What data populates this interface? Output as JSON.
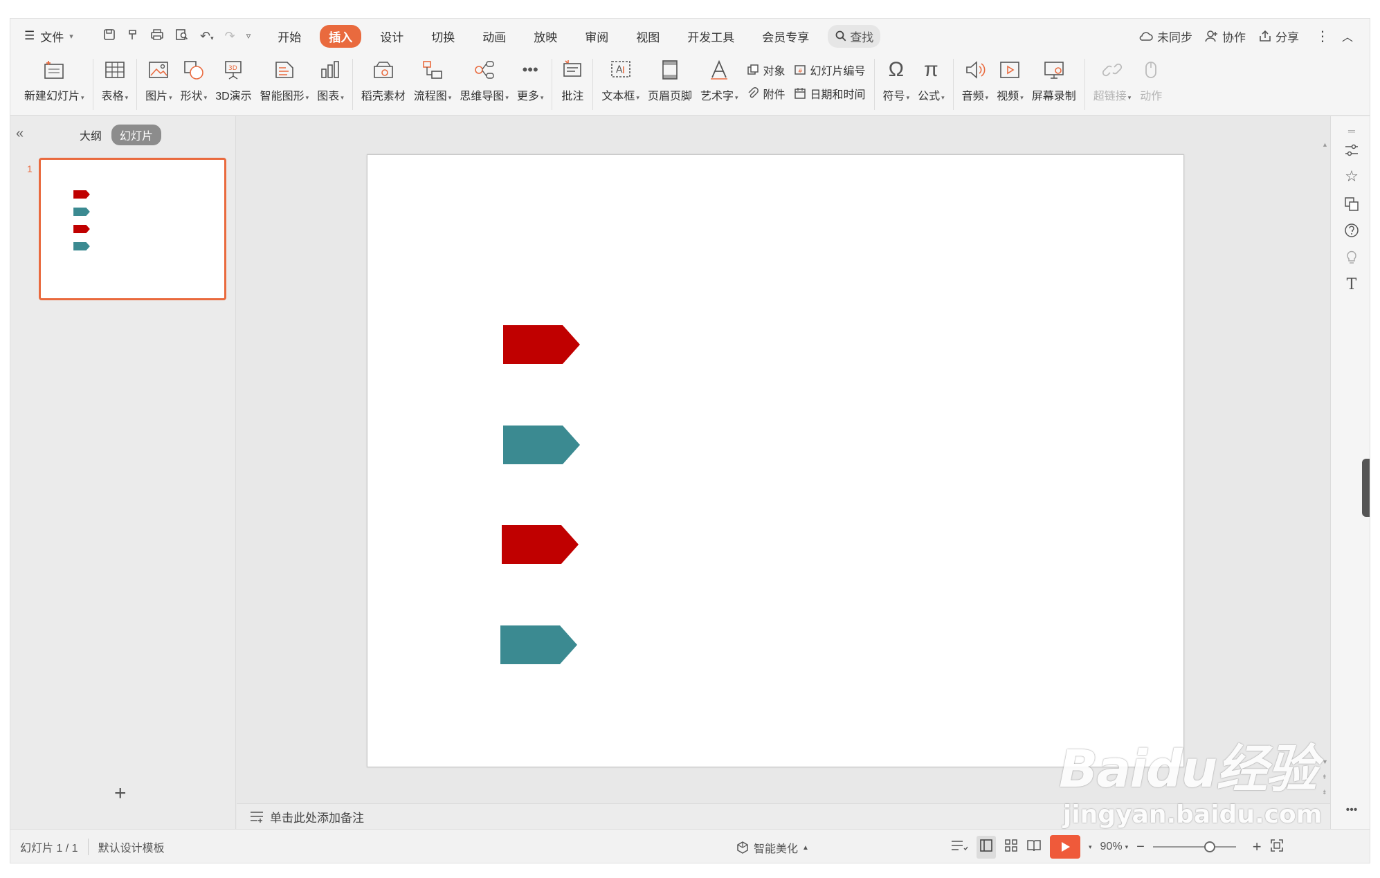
{
  "menubar": {
    "file_label": "文件",
    "tabs": [
      {
        "label": "开始"
      },
      {
        "label": "插入",
        "active": true
      },
      {
        "label": "设计"
      },
      {
        "label": "切换"
      },
      {
        "label": "动画"
      },
      {
        "label": "放映"
      },
      {
        "label": "审阅"
      },
      {
        "label": "视图"
      },
      {
        "label": "开发工具"
      },
      {
        "label": "会员专享"
      }
    ],
    "search_label": "查找",
    "sync_label": "未同步",
    "collab_label": "协作",
    "share_label": "分享"
  },
  "ribbon": {
    "new_slide": "新建幻灯片",
    "table": "表格",
    "picture": "图片",
    "shape": "形状",
    "three_d": "3D演示",
    "smart_graphic": "智能图形",
    "chart": "图表",
    "docer_material": "稻壳素材",
    "flowchart": "流程图",
    "mindmap": "思维导图",
    "more": "更多",
    "comment": "批注",
    "textbox": "文本框",
    "header_footer": "页眉页脚",
    "wordart": "艺术字",
    "object": "对象",
    "slide_number": "幻灯片编号",
    "attachment": "附件",
    "date_time": "日期和时间",
    "symbol": "符号",
    "formula": "公式",
    "audio": "音频",
    "video": "视频",
    "screen_record": "屏幕录制",
    "hyperlink": "超链接",
    "action": "动作"
  },
  "leftpane": {
    "outline_tab": "大纲",
    "slides_tab": "幻灯片",
    "slide_number": "1"
  },
  "slide": {
    "arrow_colors": [
      "#c00000",
      "#3b8a91",
      "#c00000",
      "#3b8a91"
    ]
  },
  "notes": {
    "placeholder": "单击此处添加备注"
  },
  "statusbar": {
    "slide_count": "幻灯片 1 / 1",
    "template": "默认设计模板",
    "beautify": "智能美化",
    "zoom": "90%"
  },
  "watermark": {
    "main": "Baidu经验",
    "sub": "jingyan.baidu.com"
  }
}
